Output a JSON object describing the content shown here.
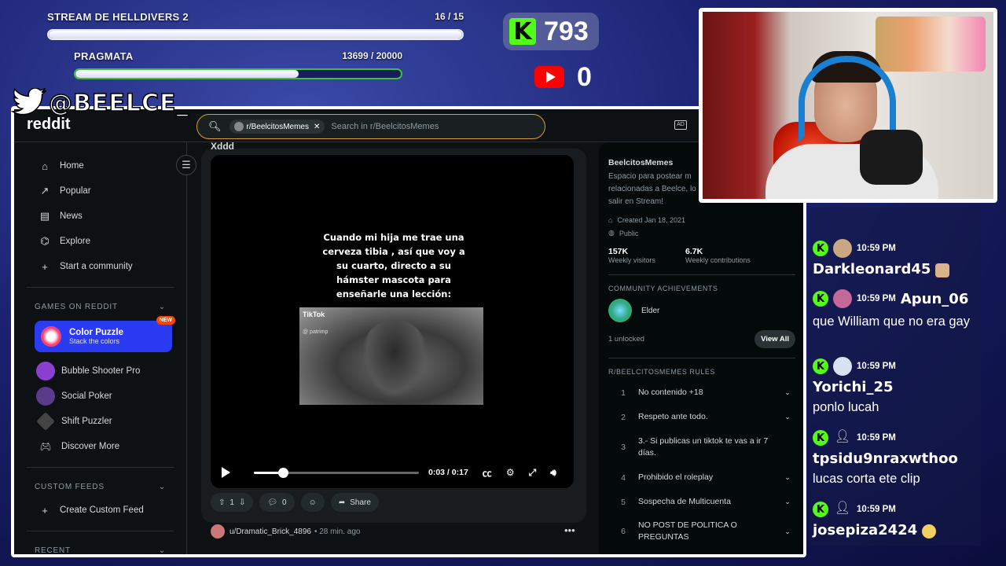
{
  "overlay": {
    "goals": [
      {
        "title": "STREAM DE HELLDIVERS 2",
        "count": "16 / 15",
        "progress": 1.0
      },
      {
        "title": "PRAGMATA",
        "count": "13699 / 20000",
        "progress": 0.685
      }
    ],
    "kick_count": "793",
    "kick_letter": "K",
    "youtube_count": "0",
    "twitter_handle": "@BEELCE_",
    "colors": {
      "kick": "#53fc18",
      "youtube": "#ff0000"
    }
  },
  "browser": {
    "logo": "reddit",
    "search": {
      "chip": "r/BeelcitosMemes",
      "placeholder": "Search in r/BeelcitosMemes"
    },
    "ad_icon": "AD"
  },
  "sidebar": {
    "nav": [
      {
        "icon": "home-icon",
        "glyph": "⌂",
        "label": "Home"
      },
      {
        "icon": "popular-icon",
        "glyph": "↗",
        "label": "Popular"
      },
      {
        "icon": "news-icon",
        "glyph": "▤",
        "label": "News"
      },
      {
        "icon": "explore-icon",
        "glyph": "⌬",
        "label": "Explore"
      },
      {
        "icon": "plus-icon",
        "glyph": "+",
        "label": "Start a community"
      }
    ],
    "games_header": "GAMES ON REDDIT",
    "featured_game": {
      "name": "Color Puzzle",
      "subtitle": "Stack the colors",
      "badge": "NEW"
    },
    "games": [
      {
        "label": "Bubble Shooter Pro",
        "color": "#8a3fd1"
      },
      {
        "label": "Social Poker",
        "color": "#5b3a8a"
      },
      {
        "label": "Shift Puzzler",
        "color": "#444"
      },
      {
        "label": "Discover More",
        "color": ""
      }
    ],
    "custom_feeds_header": "CUSTOM FEEDS",
    "create_feed": "Create Custom Feed",
    "recent_header": "RECENT"
  },
  "post": {
    "title_cut": "Xddd",
    "caption": "Cuando mi hija me trae una cerveza tibia , así que voy a su cuarto, directo a su hámster mascota para enseñarle una lección:",
    "clip_watermark": "TikTok",
    "clip_user": "@ patrimp",
    "video": {
      "time": "0:03 / 0:17",
      "progress": 0.176
    },
    "votes": "1",
    "comments": "0",
    "share": "Share",
    "next_user": "u/Dramatic_Brick_4896",
    "next_time": "• 28 min. ago"
  },
  "community": {
    "name": "BeelcitosMemes",
    "description_lines": [
      "Espacio para postear m",
      "relacionadas a Beelce, lo",
      "salir en Stream!"
    ],
    "created": "Created Jan 18, 2021",
    "visibility": "Public",
    "visitors": "157K",
    "visitors_label": "Weekly visitors",
    "contributions": "6.7K",
    "contributions_label": "Weekly contributions",
    "achievements_header": "COMMUNITY ACHIEVEMENTS",
    "achievement": "Elder",
    "unlocked": "1 unlocked",
    "view_all": "View All",
    "rules_header": "R/BEELCITOSMEMES RULES",
    "rules": [
      {
        "n": "1",
        "text": "No contenido +18",
        "chev": "⌄"
      },
      {
        "n": "2",
        "text": "Respeto ante todo.",
        "chev": "⌄"
      },
      {
        "n": "3",
        "text": "3.- Si publicas un tiktok te vas a ir 7 días.",
        "chev": ""
      },
      {
        "n": "4",
        "text": "Prohibido el roleplay",
        "chev": "⌄"
      },
      {
        "n": "5",
        "text": "Sospecha de Multicuenta",
        "chev": "⌄"
      },
      {
        "n": "6",
        "text": "NO POST DE POLITICA O PREGUNTAS",
        "chev": "⌄"
      }
    ]
  },
  "chat": [
    {
      "time": "10:59 PM",
      "user": "Darkleonard45",
      "text": "",
      "avatar": "#c9a882"
    },
    {
      "time": "10:59 PM",
      "user": "Apun_06",
      "text": "que William que no era gay",
      "avatar": "#c4689a"
    },
    {
      "time": "10:59 PM",
      "user": "Yorichi_25",
      "text": "ponlo lucah",
      "avatar": "#d8e2f0"
    },
    {
      "time": "10:59 PM",
      "user": "tpsidu9nraxwthoo",
      "text": "lucas corta ete clip",
      "avatar": ""
    },
    {
      "time": "10:59 PM",
      "user": "josepiza2424",
      "text": "",
      "avatar": ""
    }
  ]
}
